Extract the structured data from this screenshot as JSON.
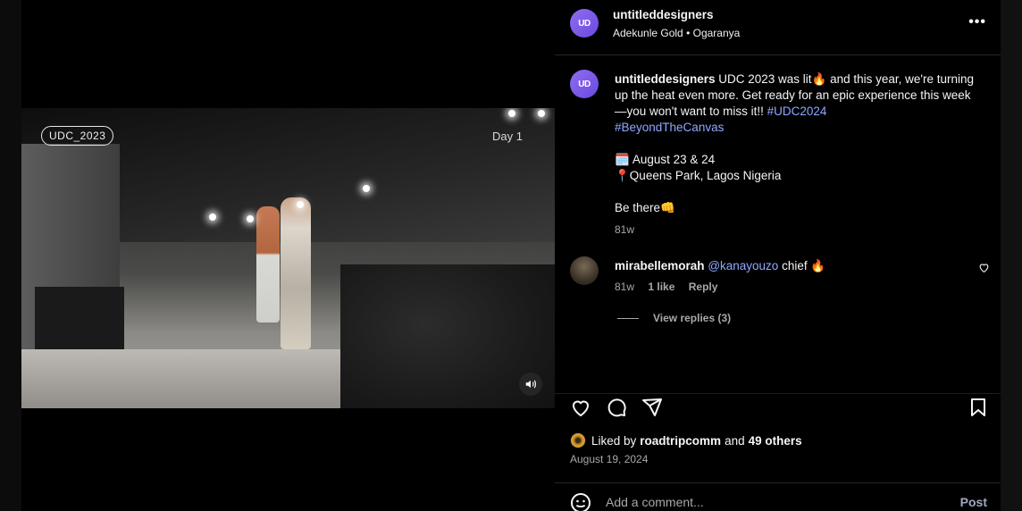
{
  "video": {
    "badge": "UDC_2023",
    "day_label": "Day 1",
    "audio_icon": "speaker-icon"
  },
  "header": {
    "avatar_text": "UD",
    "username": "untitleddesigners",
    "audio_artist": "Adekunle Gold",
    "audio_sep": " • ",
    "audio_track": "Ogaranya",
    "more": "•••"
  },
  "caption": {
    "username": "untitleddesigners",
    "text_part1": " UDC 2023 was lit🔥 and this year, we're turning up the heat even more. Get ready for an epic experience this week—you won't want to miss it!! ",
    "hashtag1": "#UDC2024",
    "hashtag2": "#BeyondTheCanvas",
    "dates_line": "🗓️ August 23 & 24",
    "location_line": "📍Queens Park, Lagos Nigeria",
    "cta_line": "Be there👊",
    "age": "81w"
  },
  "comment": {
    "username": "mirabellemorah",
    "mention": "@kanayouzo",
    "text": " chief 🔥",
    "age": "81w",
    "likes": "1 like",
    "reply": "Reply"
  },
  "replies": {
    "label": "View replies (3)"
  },
  "likes": {
    "prefix": "Liked by ",
    "user": "roadtripcomm",
    "mid": " and ",
    "others": "49 others"
  },
  "date": "August 19, 2024",
  "add_comment": {
    "placeholder": "Add a comment...",
    "post": "Post"
  }
}
